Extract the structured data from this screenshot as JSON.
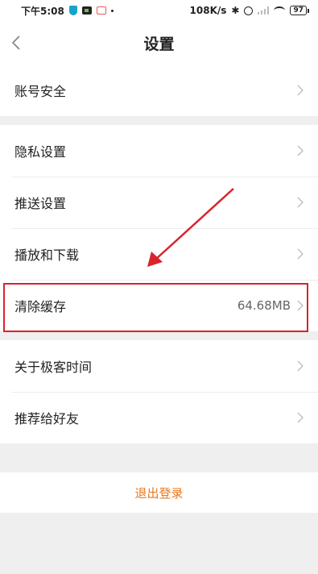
{
  "status_bar": {
    "time": "下午5:08",
    "speed": "108K/s",
    "battery": "97"
  },
  "header": {
    "title": "设置"
  },
  "groups": [
    {
      "items": [
        {
          "label": "账号安全"
        }
      ]
    },
    {
      "items": [
        {
          "label": "隐私设置"
        },
        {
          "label": "推送设置"
        },
        {
          "label": "播放和下载"
        },
        {
          "label": "清除缓存",
          "value": "64.68MB"
        }
      ]
    },
    {
      "items": [
        {
          "label": "关于极客时间"
        },
        {
          "label": "推荐给好友"
        }
      ]
    }
  ],
  "logout": {
    "label": "退出登录"
  },
  "colors": {
    "accent": "#e8771e",
    "annotation": "#d9232d",
    "background": "#efefef"
  },
  "icons": [
    "back-arrow-icon",
    "chevron-right-icon",
    "bluetooth-icon",
    "alarm-icon",
    "wifi-icon",
    "battery-icon"
  ]
}
